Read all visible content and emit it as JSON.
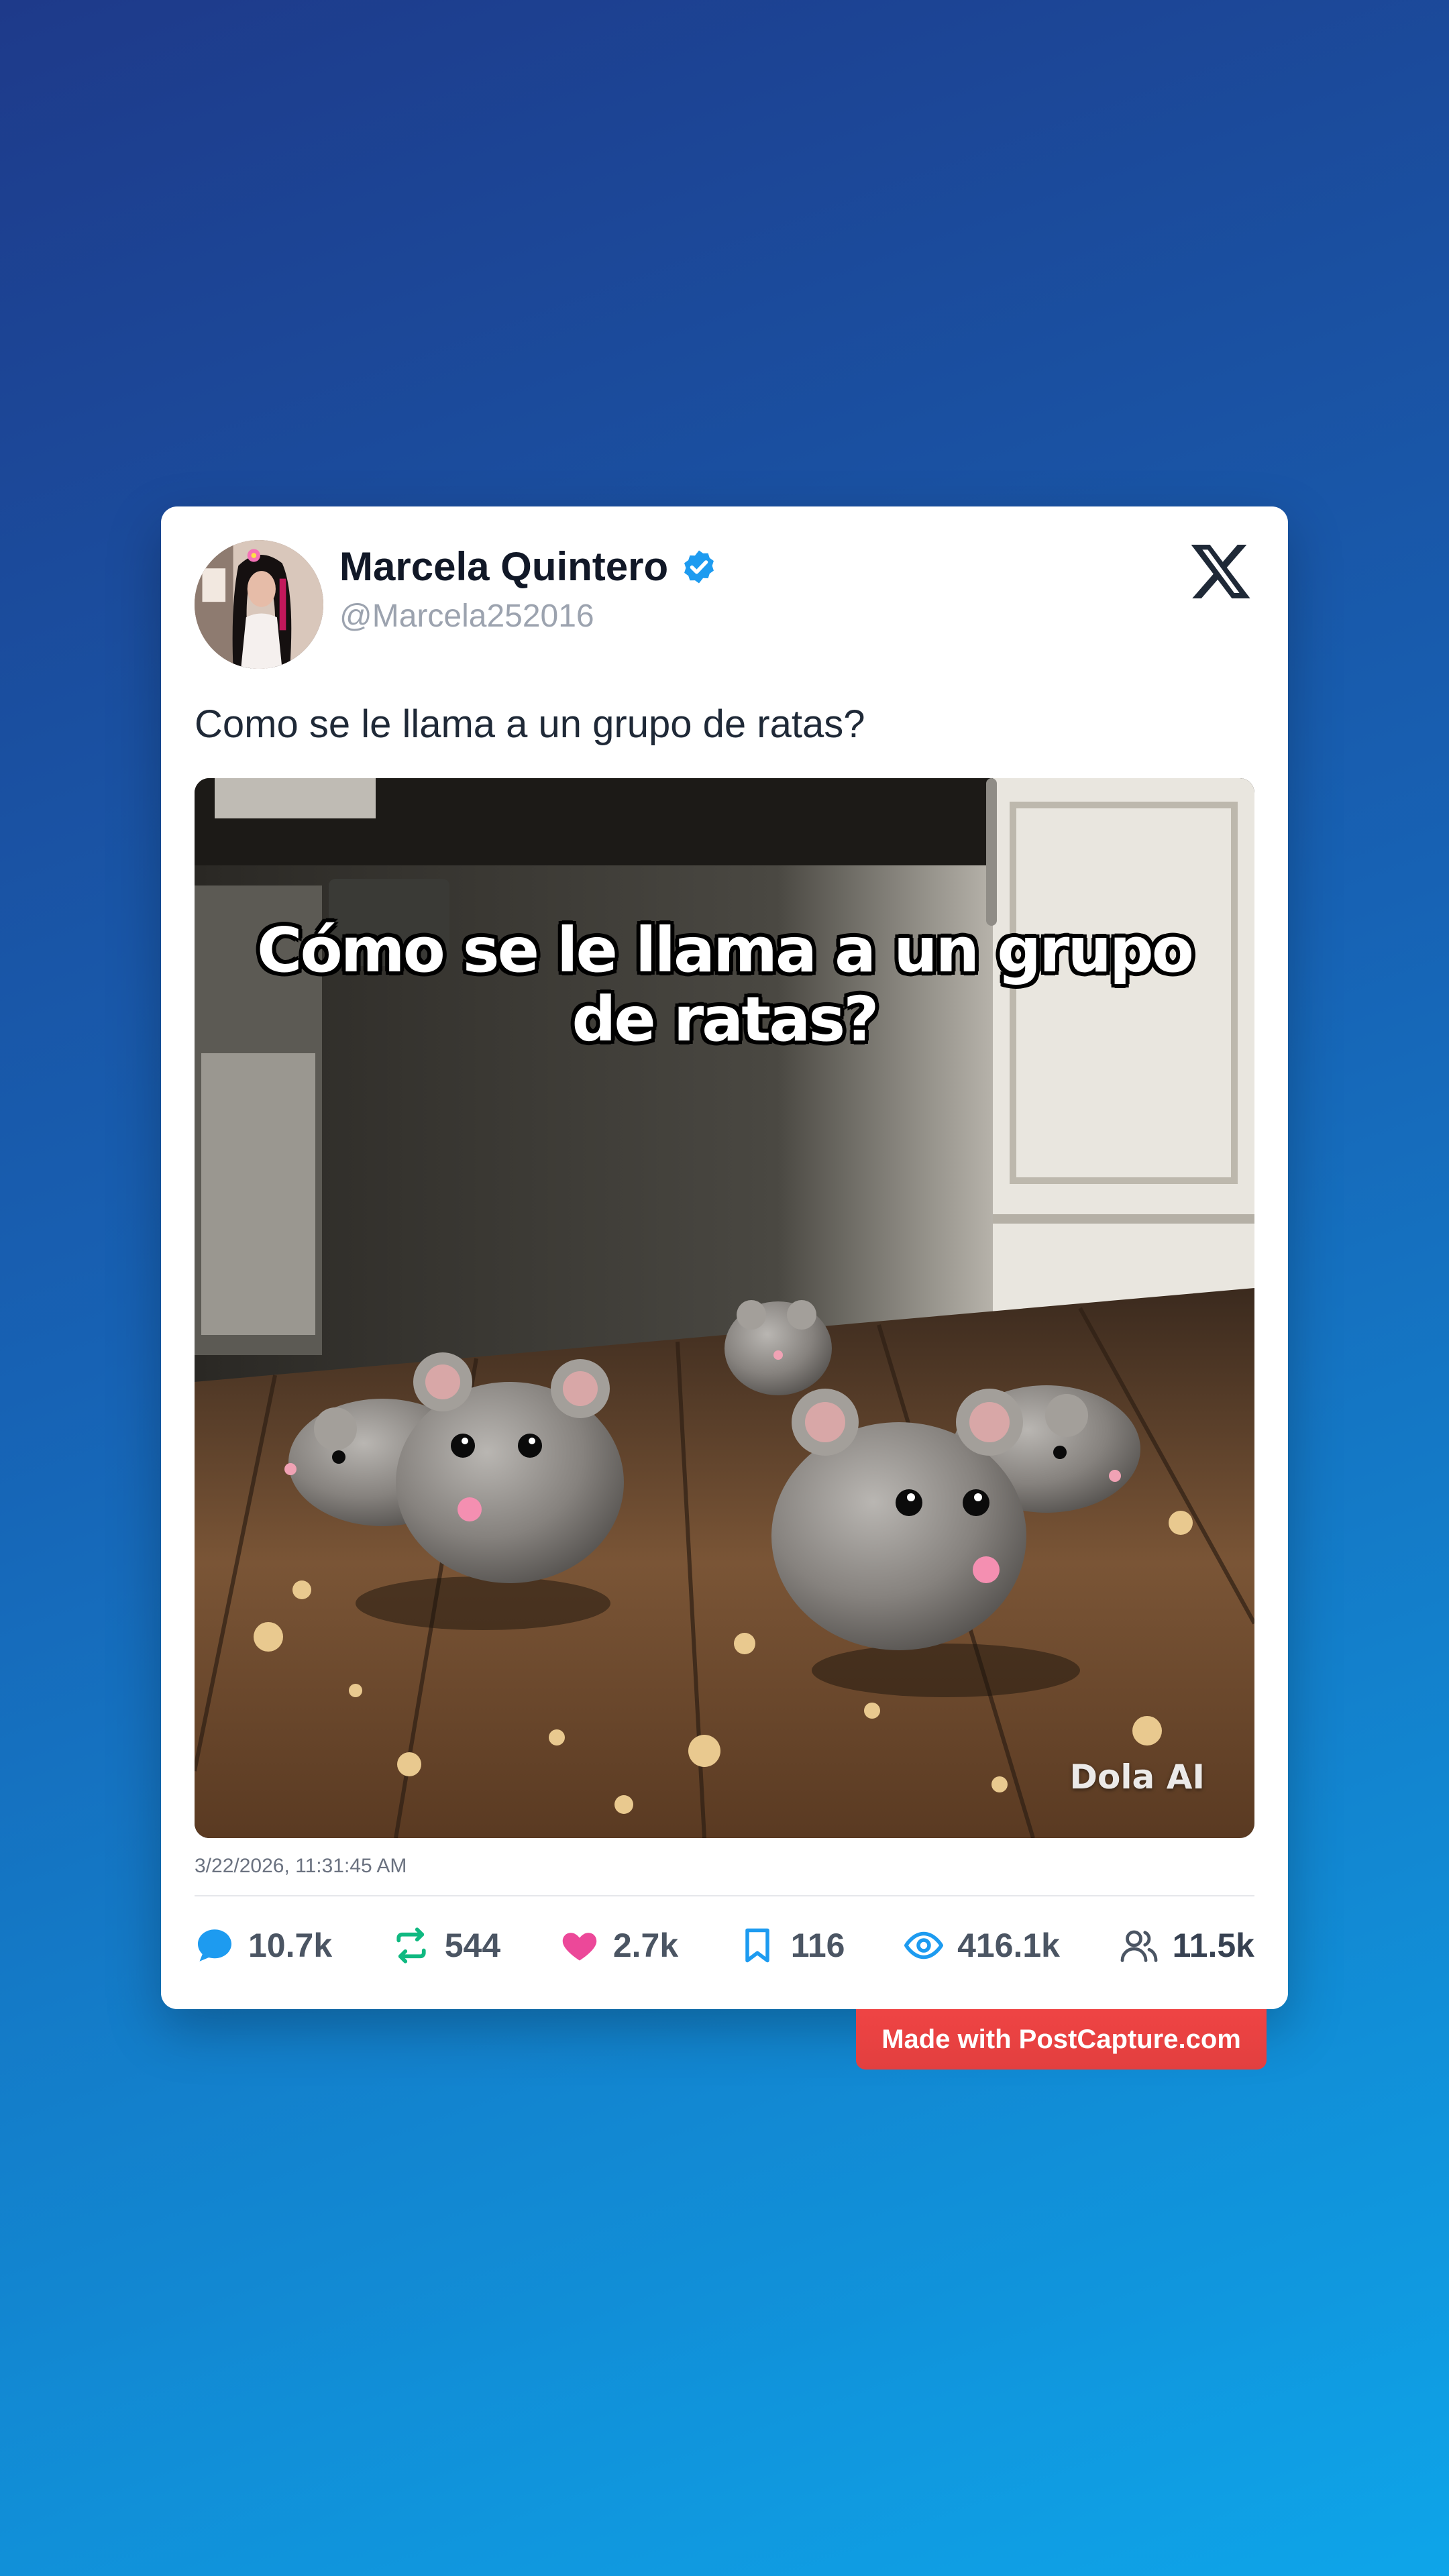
{
  "tweet": {
    "author_name": "Marcela Quintero",
    "handle": "@Marcela252016",
    "verified": true,
    "text": "Como se le llama a un grupo de ratas?",
    "image_caption": "Cómo se le llama a un grupo de ratas?",
    "image_watermark": "Dola AI",
    "timestamp": "3/22/2026, 11:31:45 AM"
  },
  "stats": {
    "replies": "10.7k",
    "retweets": "544",
    "likes": "2.7k",
    "bookmarks": "116",
    "views": "416.1k",
    "followers": "11.5k"
  },
  "icons": {
    "platform": "x-logo-icon",
    "verified": "verified-badge-icon",
    "replies": "comment-icon",
    "retweets": "retweet-icon",
    "likes": "heart-icon",
    "bookmarks": "bookmark-icon",
    "views": "eye-icon",
    "followers": "users-icon"
  },
  "colors": {
    "background_start": "#1e3a8a",
    "background_end": "#0ea5e9",
    "verified": "#1d9bf0",
    "reply": "#1d9bf0",
    "retweet": "#10b981",
    "like": "#ec4899",
    "bookmark": "#1d9bf0",
    "views": "#1d9bf0",
    "promo": "#ef4444"
  },
  "promo": {
    "label": "Made with PostCapture.com"
  }
}
